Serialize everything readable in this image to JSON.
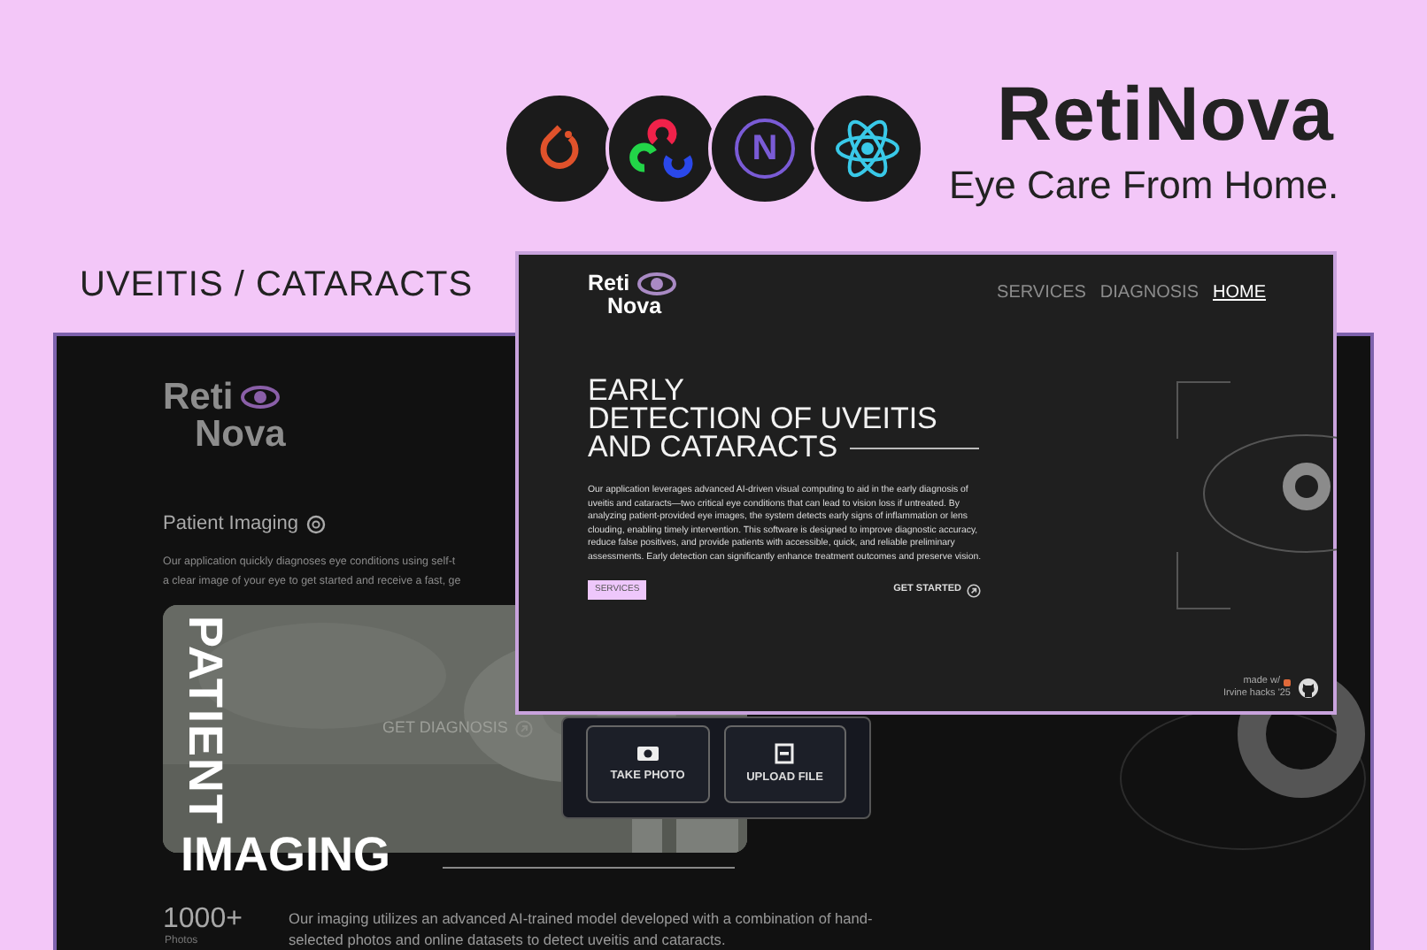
{
  "header": {
    "title": "RetiNova",
    "tagline": "Eye Care From Home."
  },
  "tech_badges": [
    {
      "kind": "flame"
    },
    {
      "kind": "rings"
    },
    {
      "kind": "letter",
      "text": "N"
    },
    {
      "kind": "atom"
    }
  ],
  "section_label": "UVEITIS / CATARACTS",
  "back_window": {
    "logo": [
      "Reti",
      "Nova"
    ],
    "heading": "Patient Imaging",
    "intro": [
      "Our application quickly diagnoses eye conditions using self-t",
      "a clear image of your eye to get started and receive a fast, ge"
    ],
    "image_card": {
      "vertical_title": "PATIENT",
      "action": "GET DIAGNOSIS",
      "title": "IMAGING"
    },
    "upload_buttons": [
      {
        "kind": "camera",
        "label": "TAKE PHOTO"
      },
      {
        "kind": "file",
        "label": "UPLOAD FILE"
      }
    ],
    "stat": {
      "value": "1000+",
      "label": "Photos"
    },
    "description": "Our imaging utilizes an advanced AI-trained model developed with a combination of hand-selected photos and online datasets to detect uveitis and cataracts."
  },
  "front_window": {
    "logo": [
      "Reti",
      "Nova"
    ],
    "nav": [
      {
        "label": "SERVICES",
        "selected": false
      },
      {
        "label": "DIAGNOSIS",
        "selected": false
      },
      {
        "label": "HOME",
        "selected": true
      }
    ],
    "headline": [
      "EARLY",
      "DETECTION OF UVEITIS",
      "AND CATARACTS"
    ],
    "paragraph": "Our application leverages advanced AI-driven visual computing to aid in the early diagnosis of uveitis and cataracts—two critical eye conditions that can lead to vision loss if untreated. By analyzing patient-provided eye images, the system detects early signs of inflammation or lens clouding, enabling timely intervention. This software is designed to improve diagnostic accuracy, reduce false positives, and provide patients with accessible, quick, and reliable preliminary assessments. Early detection can significantly enhance treatment outcomes and preserve vision.",
    "primary_button": "SERVICES",
    "secondary_button": "GET STARTED",
    "footer": [
      "made w/",
      "Irvine hacks '25"
    ]
  }
}
